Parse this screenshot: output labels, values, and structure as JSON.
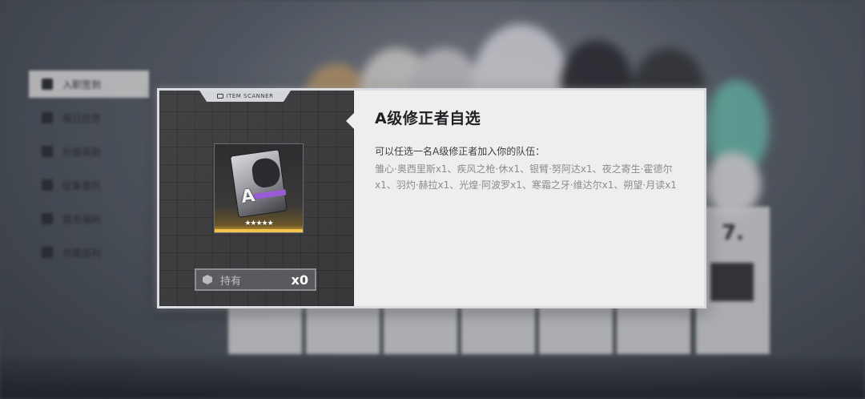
{
  "background": {
    "menu_items": [
      {
        "label": "入职签到",
        "active": true
      },
      {
        "label": "每日任务",
        "active": false
      },
      {
        "label": "升级奖励",
        "active": false
      },
      {
        "label": "征集委托",
        "active": false
      },
      {
        "label": "首充福利",
        "active": false
      },
      {
        "label": "月度返利",
        "active": false
      }
    ],
    "day_label": "7."
  },
  "modal": {
    "scanner_label": "ITEM SCANNER",
    "item_letter": "A",
    "item_stars": "★★★★★",
    "owned_label": "持有",
    "owned_count": "x0",
    "title": "A级修正者自选",
    "description_head": "可以任选一名A级修正者加入你的队伍：",
    "description_body": "雏心·奥西里斯x1、疾风之枪·休x1、银臂·努阿达x1、夜之寄生·霍德尔x1、羽灼·赫拉x1、光煌·阿波罗x1、寒霜之牙·维达尔x1、朔望·月读x1"
  },
  "colors": {
    "accent_gold": "#f2c44a",
    "accent_purple": "#9a5cd6"
  }
}
